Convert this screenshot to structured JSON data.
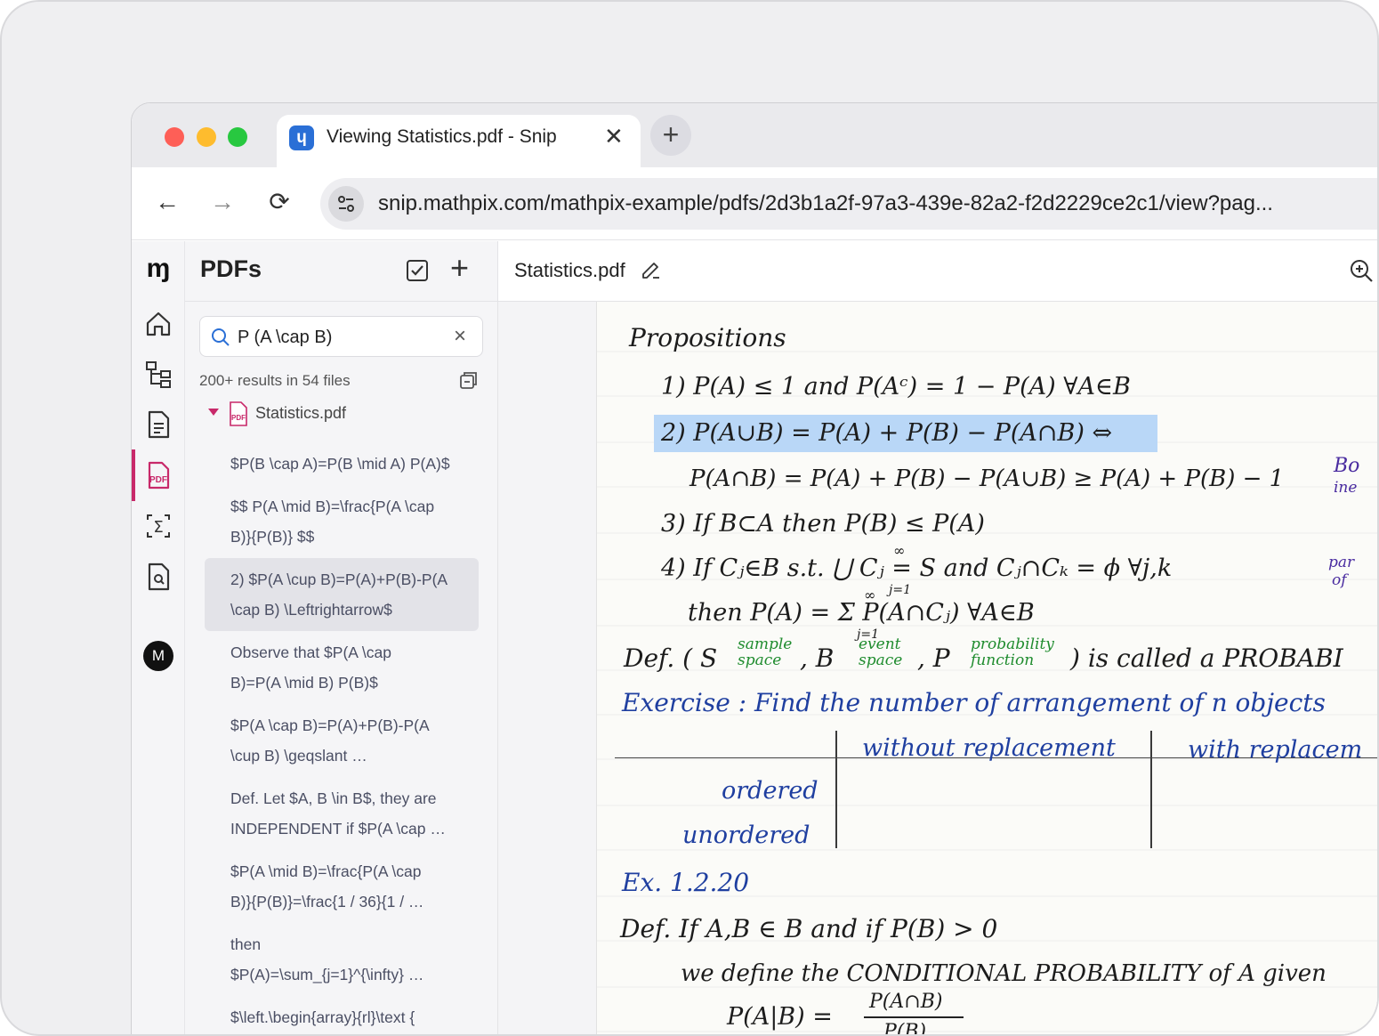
{
  "browser": {
    "tab_title": "Viewing Statistics.pdf - Snip",
    "tab_close": "✕",
    "new_tab": "+",
    "url": "snip.mathpix.com/mathpix-example/pdfs/2d3b1a2f-97a3-439e-82a2-f2d2229ce2c1/view?pag..."
  },
  "rail": {
    "avatar_letter": "M"
  },
  "sidebar": {
    "title": "PDFs",
    "search_value": "P (A \\cap B)",
    "result_count": "200+ results in 54 files",
    "file_name": "Statistics.pdf",
    "results": [
      "$P(B \\cap A)=P(B \\mid A) P(A)$",
      "$$ P(A \\mid B)=\\frac{P(A \\cap\nB)}{P(B)} $$",
      "2) $P(A \\cup B)=P(A)+P(B)-P(A\n\\cap B) \\Leftrightarrow$",
      "Observe that $P(A \\cap\nB)=P(A \\mid B) P(B)$",
      "$P(A \\cap B)=P(A)+P(B)-P(A\n\\cup B) \\geqslant …",
      "Def. Let $A, B \\in B$, they are\nINDEPENDENT if $P(A \\cap …",
      "$P(A \\mid B)=\\frac{P(A \\cap\nB)}{P(B)}=\\frac{1 / 36}{1 / …",
      "then\n$P(A)=\\sum_{j=1}^{\\infty} …",
      "$\\left.\\begin{array}{rl}\\text {\nRecall: } & (A \\cup B)^{c}=A^{…"
    ],
    "selected_index": 2
  },
  "document": {
    "title": "Statistics.pdf",
    "lines": {
      "propositions": "Propositions",
      "p1": "1) P(A) ≤ 1   and   P(Aᶜ) = 1 − P(A)    ∀A∈B",
      "p2": "2) P(A∪B) = P(A) + P(B) − P(A∩B)   ⇔",
      "p2b": "P(A∩B) = P(A) + P(B) − P(A∪B) ≥ P(A) + P(B) − 1",
      "p2b_side": "Bo",
      "p2b_side2": "ine",
      "p3": "3) If  B⊂A  then  P(B) ≤ P(A)",
      "p4": "4) If  Cⱼ∈B  s.t.  ⋃ Cⱼ = S  and  Cⱼ∩Cₖ = ϕ  ∀j,k",
      "p4_super": "∞",
      "p4_sub": "j=1",
      "p4_side": "par",
      "p4_side2": "of",
      "p4b": "then  P(A) = Σ P(A∩Cⱼ) ∀A∈B",
      "p4b_super": "∞",
      "p4b_sub": "j=1",
      "def1_a": "Def. ( S",
      "def1_sample": "sample\nspace",
      "def1_b": ",  B",
      "def1_event": "event\nspace",
      "def1_c": ",  P",
      "def1_prob": "probability\nfunction",
      "def1_d": ")  is  called  a  PROBABI",
      "exercise": "Exercise :  Find  the  number  of  arrangement  of  n  objects",
      "col_without": "without  replacement",
      "col_with": "with  replacem",
      "row_ordered": "ordered",
      "row_unordered": "unordered",
      "ex": "Ex. 1.2.20",
      "def2": "Def.  If  A,B ∈ B  and  if  P(B) > 0",
      "def2b": "we  define  the  CONDITIONAL  PROBABILITY  of  A  given",
      "formula_left": "P(A|B)  =",
      "formula_num": "P(A∩B)",
      "formula_den": "P(B)"
    }
  },
  "colors": {
    "accent": "#c8296a",
    "highlight": "#b9d7f7",
    "ink_blue": "#1f3fa0",
    "ink_green": "#1f8c2e"
  }
}
